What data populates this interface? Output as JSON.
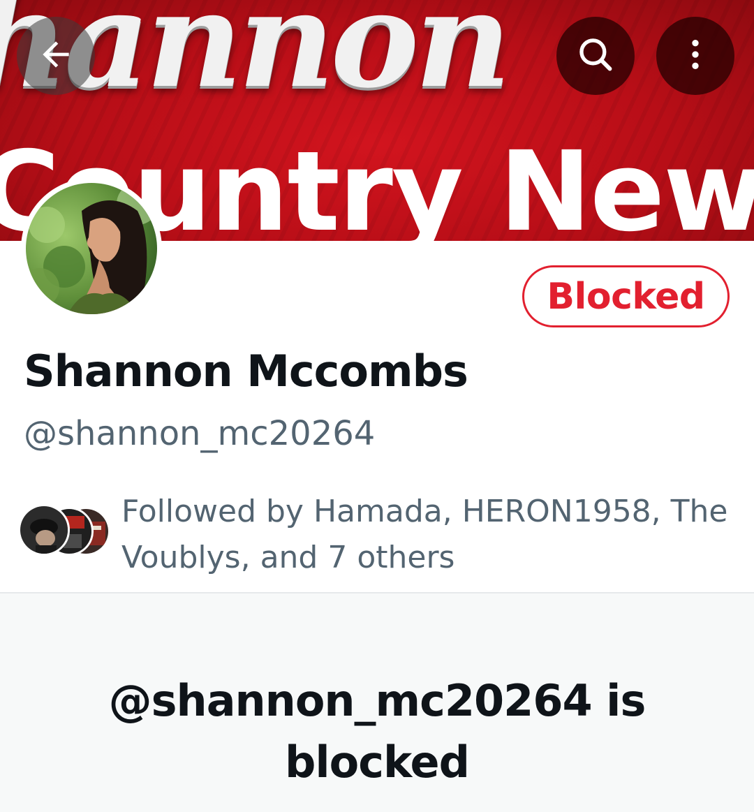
{
  "banner": {
    "word_top": "hannon",
    "word_bottom": "Country News",
    "colors": {
      "background": "#c01019",
      "text": "#ffffff"
    }
  },
  "header": {
    "back_icon": "arrow-left-icon",
    "search_icon": "search-icon",
    "more_icon": "more-vertical-icon"
  },
  "profile": {
    "display_name": "Shannon Mccombs",
    "handle": "@shannon_mc20264",
    "blocked_button_label": "Blocked",
    "followed_by_text": "Followed by Hamada, HERON1958, The Voublys, and 7 others"
  },
  "blocked_notice": {
    "title": "@shannon_mc20264 is blocked"
  },
  "colors": {
    "accent_red": "#e2202f",
    "text_primary": "#0f1419",
    "text_secondary": "#536471",
    "section_bg": "#f7f9f9"
  }
}
